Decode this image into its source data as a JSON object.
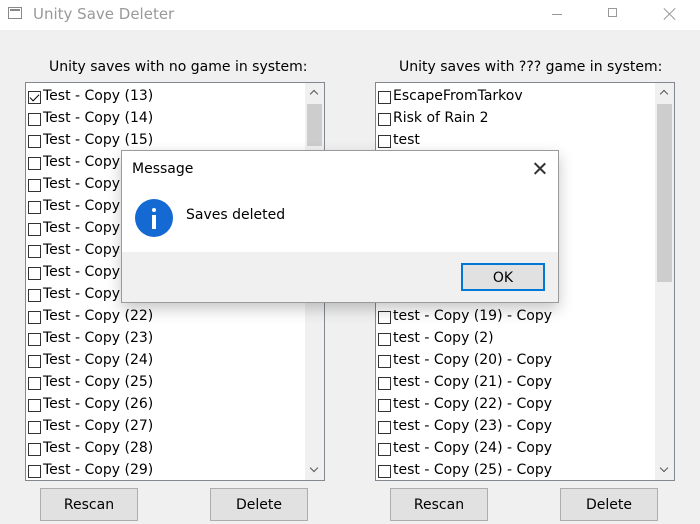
{
  "window": {
    "title": "Unity Save Deleter"
  },
  "left_panel": {
    "title": "Unity saves with no game in system:",
    "items": [
      {
        "label": "Test - Copy (13)",
        "checked": true
      },
      {
        "label": "Test - Copy (14)",
        "checked": false
      },
      {
        "label": "Test - Copy (15)",
        "checked": false
      },
      {
        "label": "Test - Copy",
        "checked": false
      },
      {
        "label": "Test - Copy",
        "checked": false
      },
      {
        "label": "Test - Copy",
        "checked": false
      },
      {
        "label": "Test - Copy",
        "checked": false
      },
      {
        "label": "Test - Copy",
        "checked": false
      },
      {
        "label": "Test - Copy",
        "checked": false
      },
      {
        "label": "Test - Copy",
        "checked": false
      },
      {
        "label": "Test - Copy (22)",
        "checked": false
      },
      {
        "label": "Test - Copy (23)",
        "checked": false
      },
      {
        "label": "Test - Copy (24)",
        "checked": false
      },
      {
        "label": "Test - Copy (25)",
        "checked": false
      },
      {
        "label": "Test - Copy (26)",
        "checked": false
      },
      {
        "label": "Test - Copy (27)",
        "checked": false
      },
      {
        "label": "Test - Copy (28)",
        "checked": false
      },
      {
        "label": "Test - Copy (29)",
        "checked": false
      }
    ],
    "rescan_label": "Rescan",
    "delete_label": "Delete"
  },
  "right_panel": {
    "title": "Unity saves with ??? game in system:",
    "items": [
      {
        "label": "EscapeFromTarkov",
        "checked": false
      },
      {
        "label": "Risk of Rain 2",
        "checked": false
      },
      {
        "label": "test",
        "checked": false
      },
      {
        "label": "",
        "checked": false
      },
      {
        "label": "",
        "checked": false
      },
      {
        "label": "",
        "checked": false
      },
      {
        "label": "",
        "checked": false
      },
      {
        "label": "",
        "checked": false
      },
      {
        "label": "",
        "checked": false
      },
      {
        "label": "",
        "checked": false
      },
      {
        "label": "test - Copy (19) - Copy",
        "checked": false
      },
      {
        "label": "test - Copy (2)",
        "checked": false
      },
      {
        "label": "test - Copy (20) - Copy",
        "checked": false
      },
      {
        "label": "test - Copy (21) - Copy",
        "checked": false
      },
      {
        "label": "test - Copy (22) - Copy",
        "checked": false
      },
      {
        "label": "test - Copy (23) - Copy",
        "checked": false
      },
      {
        "label": "test - Copy (24) - Copy",
        "checked": false
      },
      {
        "label": "test - Copy (25) - Copy",
        "checked": false
      }
    ],
    "rescan_label": "Rescan",
    "delete_label": "Delete"
  },
  "dialog": {
    "title": "Message",
    "message": "Saves deleted",
    "ok_label": "OK",
    "icon": "info-icon"
  },
  "colors": {
    "accent": "#0078d7",
    "info_icon": "#1469d3"
  }
}
